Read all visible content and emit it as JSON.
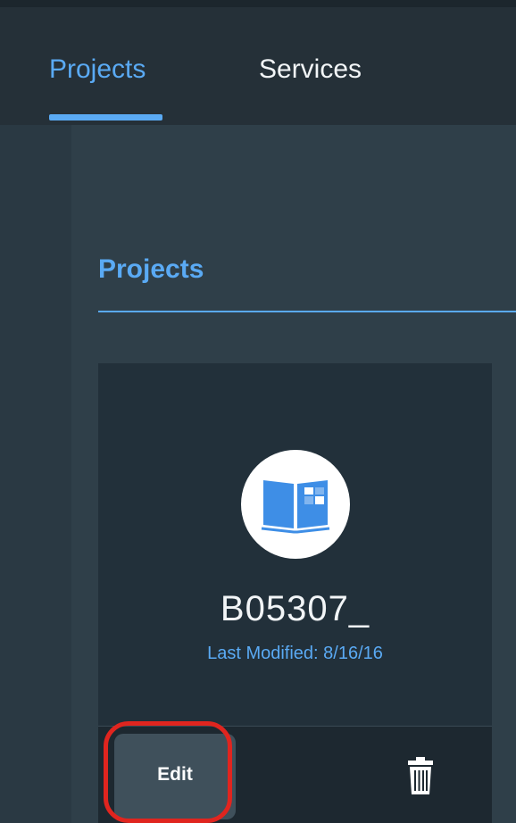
{
  "nav": {
    "tabs": [
      {
        "label": "Projects",
        "active": true
      },
      {
        "label": "Services",
        "active": false
      }
    ]
  },
  "section": {
    "title": "Projects"
  },
  "project_card": {
    "name": "B05307_",
    "last_modified": "Last Modified: 8/16/16",
    "icon": "open-book-icon",
    "edit_label": "Edit",
    "delete_icon": "trash-icon"
  },
  "colors": {
    "accent": "#5aaaf4",
    "background": "#2f3f49",
    "nav_background": "#253038",
    "card_background": "#22303a",
    "highlight": "#e0251f"
  }
}
